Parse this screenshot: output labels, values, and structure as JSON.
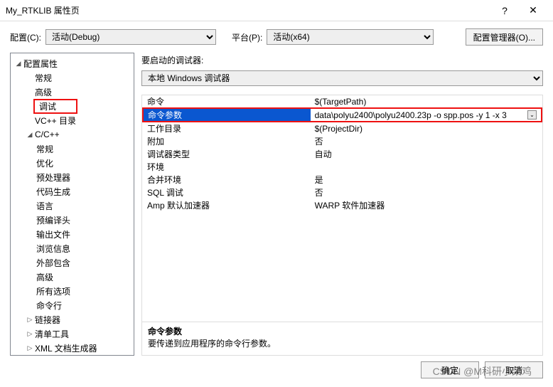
{
  "titlebar": {
    "title": "My_RTKLIB 属性页",
    "help": "?",
    "close": "✕"
  },
  "config": {
    "cfg_label": "配置(C):",
    "cfg_value": "活动(Debug)",
    "plat_label": "平台(P):",
    "plat_value": "活动(x64)",
    "cfg_mgr": "配置管理器(O)..."
  },
  "tree": {
    "root": "配置属性",
    "items_l1a": [
      "常规",
      "高级",
      "调试",
      "VC++ 目录"
    ],
    "cpp": "C/C++",
    "cpp_children": [
      "常规",
      "优化",
      "预处理器",
      "代码生成",
      "语言",
      "预编译头",
      "输出文件",
      "浏览信息",
      "外部包含",
      "高级",
      "所有选项",
      "命令行"
    ],
    "items_l1b": [
      "链接器",
      "清单工具",
      "XML 文档生成器"
    ]
  },
  "right": {
    "section_label": "要启动的调试器:",
    "debugger": "本地 Windows 调试器",
    "rows": [
      {
        "k": "命令",
        "v": "$(TargetPath)"
      },
      {
        "k": "命令参数",
        "v": "data\\polyu2400\\polyu2400.23p -o spp.pos -y 1 -x 3"
      },
      {
        "k": "工作目录",
        "v": "$(ProjectDir)"
      },
      {
        "k": "附加",
        "v": "否"
      },
      {
        "k": "调试器类型",
        "v": "自动"
      },
      {
        "k": "环境",
        "v": ""
      },
      {
        "k": "合并环境",
        "v": "是"
      },
      {
        "k": "SQL 调试",
        "v": "否"
      },
      {
        "k": "Amp 默认加速器",
        "v": "WARP 软件加速器"
      }
    ],
    "desc_title": "命令参数",
    "desc_text": "要传递到应用程序的命令行参数。"
  },
  "footer": {
    "ok": "确定",
    "cancel": "取消"
  },
  "watermark": "CSDN @M科研小菜鸡"
}
